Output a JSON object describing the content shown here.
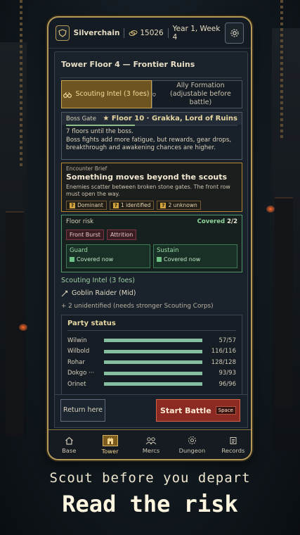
{
  "header": {
    "guild_name": "Silverchain",
    "gold": "15026",
    "date": "Year 1, Week 4"
  },
  "panel": {
    "title": "Tower Floor 4 — Frontier Ruins",
    "tabs": [
      {
        "label": "Scouting Intel (3 foes)",
        "active": true
      },
      {
        "label": "Ally Formation (adjustable before battle)",
        "active": false
      }
    ]
  },
  "boss_gate": {
    "label": "Boss Gate",
    "target": "★ Floor 10 · Grakka, Lord of Ruins",
    "progress": 0.4,
    "floors_left": "7 floors until the boss.",
    "note": "Boss fights add more fatigue, but rewards, gear drops, breakthrough and awakening chances are higher."
  },
  "encounter": {
    "label": "Encounter Brief",
    "title": "Something moves beyond the scouts",
    "desc": "Enemies scatter between broken stone gates. The front row must open the way.",
    "chips": [
      "Dominant",
      "1 identified",
      "2 unknown"
    ],
    "chip_mark": "?"
  },
  "risk": {
    "label": "Floor risk",
    "covered_label": "Covered",
    "covered_count": "2/2",
    "tags": [
      "Front Burst",
      "Attrition"
    ],
    "roles": [
      {
        "name": "Guard",
        "status": "Covered now"
      },
      {
        "name": "Sustain",
        "status": "Covered now"
      }
    ]
  },
  "intel": {
    "title": "Scouting Intel (3 foes)",
    "foe": "Goblin Raider (Mid)",
    "unidentified": "+ 2 unidentified (needs stronger Scouting Corps)"
  },
  "party": {
    "title": "Party status",
    "members": [
      {
        "name": "Wilwin",
        "hp": 57,
        "max": 57,
        "text": "57/57"
      },
      {
        "name": "Wilbold",
        "hp": 116,
        "max": 116,
        "text": "116/116"
      },
      {
        "name": "Rohar",
        "hp": 128,
        "max": 128,
        "text": "128/128"
      },
      {
        "name": "Dokgo ···",
        "hp": 93,
        "max": 93,
        "text": "93/93"
      },
      {
        "name": "Orinet",
        "hp": 96,
        "max": 96,
        "text": "96/96"
      }
    ]
  },
  "actions": {
    "return_label": "Return here",
    "battle_label": "Start Battle",
    "battle_key": "Space"
  },
  "nav": {
    "items": [
      {
        "label": "Base",
        "icon": "home-icon"
      },
      {
        "label": "Tower",
        "icon": "tower-icon",
        "active": true
      },
      {
        "label": "Mercs",
        "icon": "mercs-icon"
      },
      {
        "label": "Dungeon",
        "icon": "dungeon-icon"
      },
      {
        "label": "Records",
        "icon": "records-icon"
      }
    ]
  },
  "promo": {
    "subtitle": "Scout before you depart",
    "headline": "Read the risk"
  },
  "colors": {
    "accent_gold": "#b69a5a",
    "danger_red": "#8a2a22",
    "safe_green": "#4f9a6d"
  }
}
